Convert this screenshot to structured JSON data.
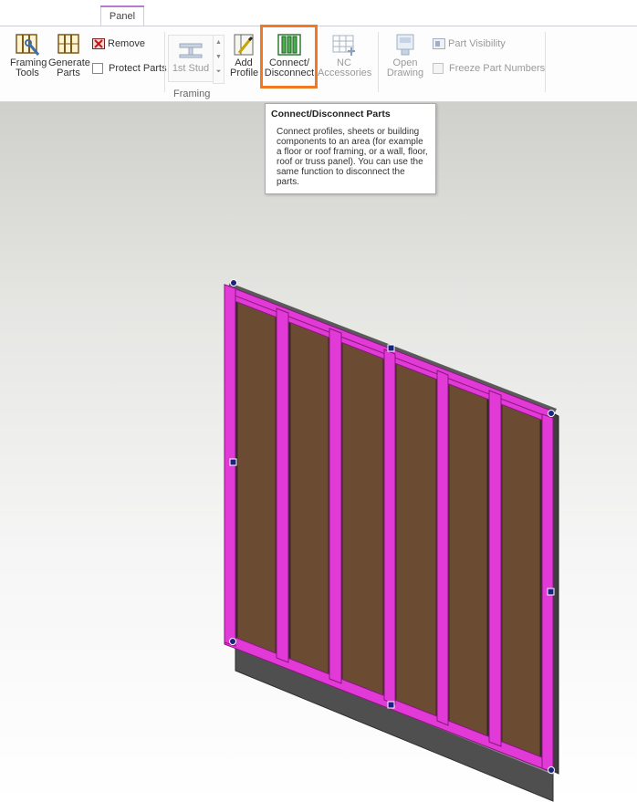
{
  "tabs": [
    {
      "label": "Panel"
    }
  ],
  "ribbon": {
    "framing_tools_label": "Framing Tools",
    "generate_parts_label": "Generate Parts",
    "remove_label": "Remove",
    "protect_parts_label": "Protect Parts",
    "first_stud_label": "1st Stud",
    "add_profile_label": "Add Profile",
    "connect_disconnect_label": "Connect/ Disconnect",
    "nc_accessories_label": "NC Accessories",
    "open_drawing_label": "Open Drawing",
    "part_visibility_label": "Part Visibility",
    "freeze_part_numbers_label": "Freeze Part Numbers",
    "group_label": "Framing"
  },
  "tooltip": {
    "title": "Connect/Disconnect Parts",
    "body": "Connect profiles, sheets or building components to an area (for example a floor or roof framing, or a wall, floor, roof or truss panel). You can use the same function to disconnect the parts."
  },
  "colors": {
    "highlight": "#f07a24",
    "framing": "#e23ad6",
    "sheathing": "#6b4c33",
    "handle": "#1a237e",
    "tab_accent": "#b37bd6"
  }
}
